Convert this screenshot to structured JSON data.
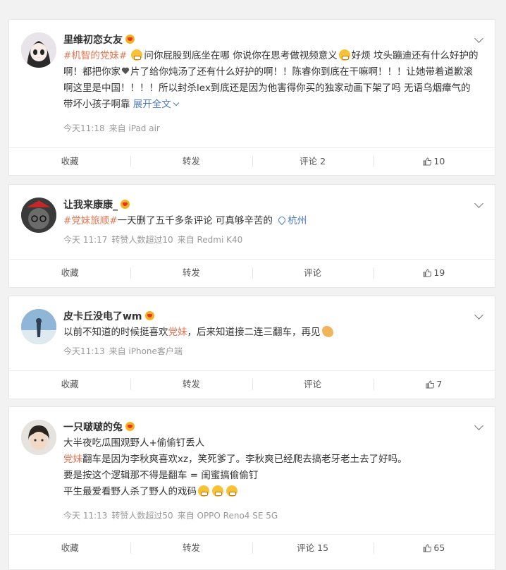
{
  "posts": [
    {
      "user": "里维初恋女友",
      "text": [
        {
          "t": "topic",
          "v": "#机智的"
        },
        {
          "t": "hl",
          "v": "党妹"
        },
        {
          "t": "topic",
          "v": "#"
        },
        {
          "t": "emoji",
          "v": "grin"
        },
        {
          "t": "text",
          "v": "问你屁股到底坐在哪 你说你在思考做视频意义"
        },
        {
          "t": "emoji",
          "v": "shock"
        },
        {
          "t": "text",
          "v": "好烦 坟头蹦迪还有什么好护的啊！都把你家"
        },
        {
          "t": "heart",
          "v": "heart"
        },
        {
          "t": "text",
          "v": "片了给你炖汤了还有什么好护的啊！！陈睿你到底在干嘛啊！！！让她带着道歉滚啊这里是中国！！！！所以封杀lex到底还是因为他害得你买的独家动画下架了吗 无语乌烟瘴气的 带坏小孩子啊靠 "
        },
        {
          "t": "expand",
          "v": "展开全文"
        }
      ],
      "meta": [
        "今天11:18",
        "来自 iPad air"
      ],
      "actions": {
        "fav": "收藏",
        "share": "转发",
        "comment": "评论 2",
        "like": "10"
      }
    },
    {
      "user": "让我来康康_",
      "text": [
        {
          "t": "topic",
          "v": "#"
        },
        {
          "t": "hl",
          "v": "党妹"
        },
        {
          "t": "topic",
          "v": "旅顺#"
        },
        {
          "t": "text",
          "v": "一天删了五千多条评论 可真够辛苦的 "
        },
        {
          "t": "loc",
          "v": "杭州"
        }
      ],
      "meta": [
        "今天 11:17",
        "转赞人数超过10",
        "来自 Redmi K40"
      ],
      "actions": {
        "fav": "收藏",
        "share": "转发",
        "comment": "评论",
        "like": "19"
      }
    },
    {
      "user": "皮卡丘没电了wm",
      "text": [
        {
          "t": "text",
          "v": "以前不知道的时候挺喜欢"
        },
        {
          "t": "hl",
          "v": "党妹"
        },
        {
          "t": "text",
          "v": "，后来知道接二连三翻车，再见"
        },
        {
          "t": "wave",
          "v": "wave"
        }
      ],
      "meta": [
        "今天11:13",
        "来自 iPhone客户端"
      ],
      "actions": {
        "fav": "收藏",
        "share": "转发",
        "comment": "评论",
        "like": "7"
      }
    },
    {
      "user": "一只啵啵的兔",
      "lines": [
        [
          {
            "t": "text",
            "v": "大半夜吃瓜围观野人+偷偷钉丢人"
          }
        ],
        [
          {
            "t": "hl",
            "v": "党妹"
          },
          {
            "t": "text",
            "v": "翻车是因为李秋爽喜欢xz，笑死爹了。李秋爽已经爬去搞老牙老土去了好吗。"
          }
        ],
        [
          {
            "t": "text",
            "v": "要是按这个逻辑那不得是翻车 = 闺蜜搞偷偷钉"
          }
        ],
        [
          {
            "t": "text",
            "v": "平生最爱看野人杀了野人的戏码"
          },
          {
            "t": "emoji",
            "v": "grin"
          },
          {
            "t": "emoji",
            "v": "grin"
          },
          {
            "t": "emoji",
            "v": "grin"
          }
        ]
      ],
      "meta": [
        "今天 11:13",
        "转赞人数超过50",
        "来自 OPPO Reno4 SE 5G"
      ],
      "actions": {
        "fav": "收藏",
        "share": "转发",
        "comment": "评论 15",
        "like": "65"
      }
    }
  ]
}
